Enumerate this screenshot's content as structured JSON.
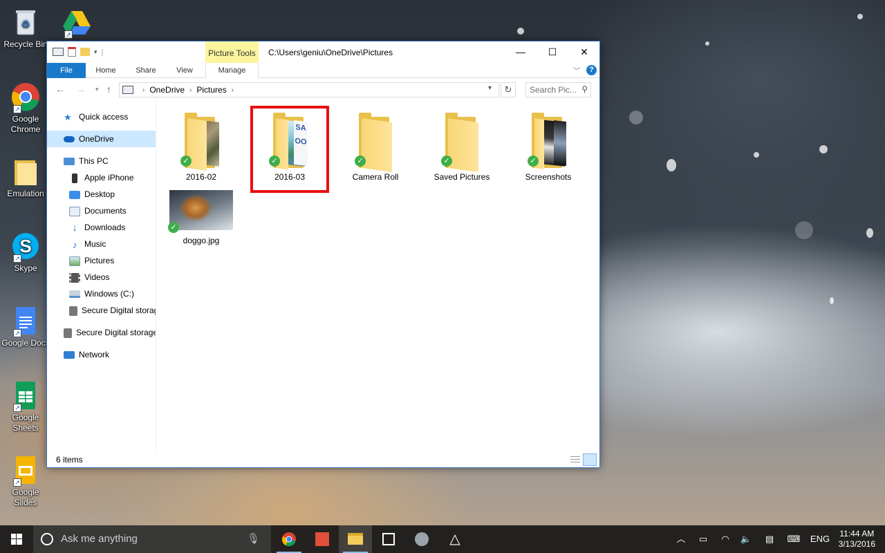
{
  "desktop_icons": [
    {
      "label": "Recycle Bin",
      "icon": "recycle-bin-icon"
    },
    {
      "label": "Google Chrome",
      "icon": "chrome-icon"
    },
    {
      "label": "Emulation",
      "icon": "folder-icon"
    },
    {
      "label": "Skype",
      "icon": "skype-icon"
    },
    {
      "label": "Google Docs",
      "icon": "google-docs-icon"
    },
    {
      "label": "Google Sheets",
      "icon": "google-sheets-icon"
    },
    {
      "label": "Google Slides",
      "icon": "google-slides-icon"
    }
  ],
  "window": {
    "contextual_tab": "Picture Tools",
    "title": "C:\\Users\\geniu\\OneDrive\\Pictures",
    "buttons": {
      "minimize": "—",
      "maximize": "☐",
      "close": "✕"
    }
  },
  "ribbon": {
    "tabs": [
      "File",
      "Home",
      "Share",
      "View",
      "Manage"
    ]
  },
  "address_bar": {
    "crumbs": [
      "OneDrive",
      "Pictures"
    ],
    "search_placeholder": "Search Pic..."
  },
  "sidebar": {
    "items": [
      {
        "label": "Quick access",
        "icon": "star-icon",
        "color": "#2f7fd6"
      },
      {
        "label": "OneDrive",
        "icon": "onedrive-cloud-icon",
        "color": "#1565c0",
        "selected": true
      },
      {
        "label": "This PC",
        "icon": "monitor-icon",
        "color": "#4a8fd4"
      },
      {
        "label": "Apple iPhone",
        "icon": "phone-icon",
        "color": "#333333"
      },
      {
        "label": "Desktop",
        "icon": "desktop-icon",
        "color": "#3a8ee6"
      },
      {
        "label": "Documents",
        "icon": "documents-icon",
        "color": "#7a9bbf"
      },
      {
        "label": "Downloads",
        "icon": "downloads-icon",
        "color": "#2a78d0"
      },
      {
        "label": "Music",
        "icon": "music-icon",
        "color": "#2a78d0"
      },
      {
        "label": "Pictures",
        "icon": "pictures-icon",
        "color": "#6fae5a"
      },
      {
        "label": "Videos",
        "icon": "videos-icon",
        "color": "#555555"
      },
      {
        "label": "Windows (C:)",
        "icon": "drive-icon",
        "color": "#5a8fc4"
      },
      {
        "label": "Secure Digital storag",
        "icon": "sd-card-icon",
        "color": "#666666"
      },
      {
        "label": "Secure Digital storage",
        "icon": "sd-card-icon",
        "color": "#666666"
      },
      {
        "label": "Network",
        "icon": "network-icon",
        "color": "#2f7fd6"
      }
    ]
  },
  "files": [
    {
      "name": "2016-02",
      "type": "folder",
      "synced": true
    },
    {
      "name": "2016-03",
      "type": "folder",
      "synced": true,
      "highlighted": true
    },
    {
      "name": "Camera Roll",
      "type": "folder",
      "synced": true
    },
    {
      "name": "Saved Pictures",
      "type": "folder",
      "synced": true
    },
    {
      "name": "Screenshots",
      "type": "folder",
      "synced": true
    },
    {
      "name": "doggo.jpg",
      "type": "image",
      "synced": true
    }
  ],
  "status": {
    "item_count": "6 items"
  },
  "taskbar": {
    "search_placeholder": "Ask me anything",
    "language": "ENG",
    "time": "11:44 AM",
    "date": "3/13/2016"
  },
  "colors": {
    "accent": "#1979ca",
    "selection": "#cce8ff",
    "highlight_border": "#e81010",
    "picture_tools": "#fbf59b",
    "sync_check": "#3fae49"
  }
}
